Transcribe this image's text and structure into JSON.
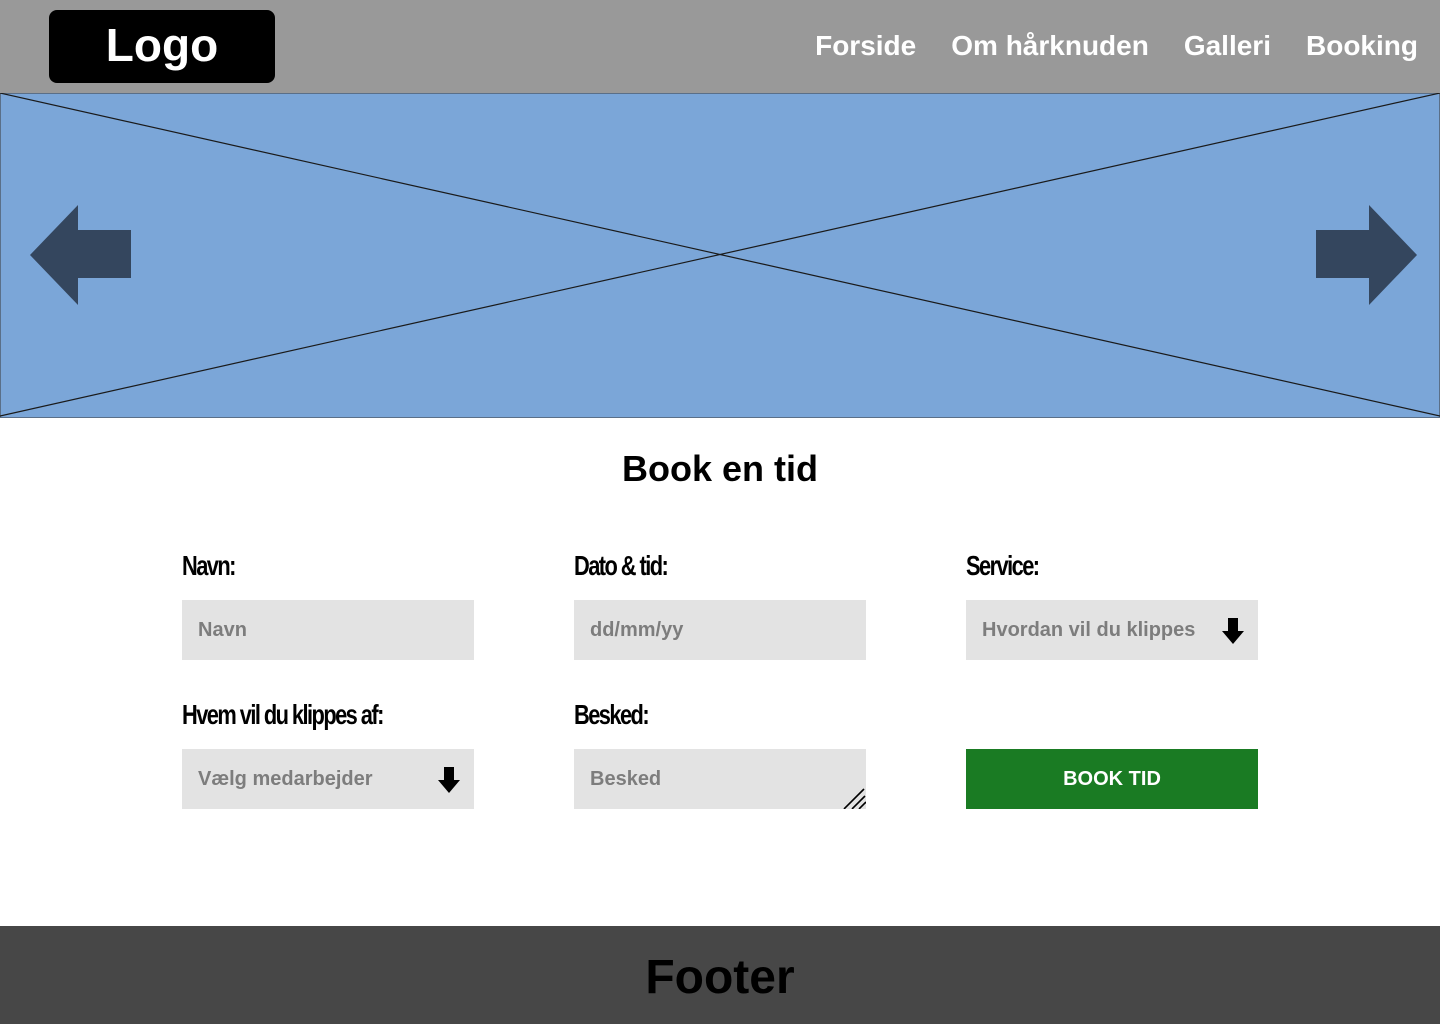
{
  "header": {
    "logo": "Logo",
    "nav": [
      {
        "label": "Forside"
      },
      {
        "label": "Om hårknuden"
      },
      {
        "label": "Galleri"
      },
      {
        "label": "Booking"
      }
    ]
  },
  "hero": {
    "prev_icon": "arrow-left-icon",
    "next_icon": "arrow-right-icon",
    "colors": {
      "background": "#7ba6d8",
      "arrows": "#34465e"
    }
  },
  "booking": {
    "title": "Book en tid",
    "name": {
      "label": "Navn:",
      "placeholder": "Navn"
    },
    "datetime": {
      "label": "Dato & tid:",
      "placeholder": "dd/mm/yy"
    },
    "service": {
      "label": "Service:",
      "placeholder": "Hvordan vil du klippes"
    },
    "staff": {
      "label": "Hvem vil du klippes af:",
      "placeholder": "Vælg medarbejder"
    },
    "message": {
      "label": "Besked:",
      "placeholder": "Besked"
    },
    "submit_label": "BOOK TID",
    "colors": {
      "submit": "#1a7b23",
      "field": "#e3e3e3"
    }
  },
  "footer": {
    "text": "Footer"
  }
}
